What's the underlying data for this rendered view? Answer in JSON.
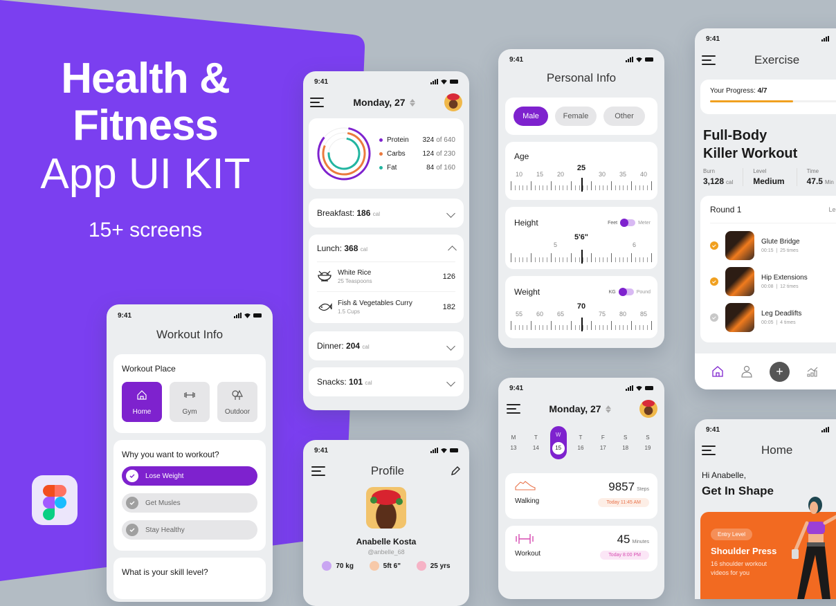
{
  "colors": {
    "accent": "#7e22ce",
    "background_purple": "#7b3ff0",
    "orange": "#f26a21",
    "progress": "#f0a020"
  },
  "hero": {
    "line1": "Health &",
    "line2": "Fitness",
    "line3": "App UI KIT",
    "subtitle": "15+ screens"
  },
  "status_time": "9:41",
  "nutrition": {
    "date": "Monday, 27",
    "macros": [
      {
        "name": "Protein",
        "value": "324",
        "of": "of 640",
        "color": "#7e22ce",
        "progress": 0.506
      },
      {
        "name": "Carbs",
        "value": "124",
        "of": "of 230",
        "color": "#ea7a3e",
        "progress": 0.539
      },
      {
        "name": "Fat",
        "value": "84",
        "of": "of 160",
        "color": "#22b5a0",
        "progress": 0.525
      }
    ],
    "meals": {
      "breakfast": {
        "label": "Breakfast:",
        "cal": "186",
        "unit": "cal"
      },
      "lunch": {
        "label": "Lunch:",
        "cal": "368",
        "unit": "cal",
        "items": [
          {
            "name": "White Rice",
            "qty": "25 Teaspoons",
            "cal": "126",
            "icon": "rice-bowl-icon"
          },
          {
            "name": "Fish & Vegetables Curry",
            "qty": "1.5 Cups",
            "cal": "182",
            "icon": "fish-icon"
          }
        ]
      },
      "dinner": {
        "label": "Dinner:",
        "cal": "204",
        "unit": "cal"
      },
      "snacks": {
        "label": "Snacks:",
        "cal": "101",
        "unit": "cal"
      }
    }
  },
  "personal_info": {
    "title": "Personal Info",
    "genders": [
      "Male",
      "Female",
      "Other"
    ],
    "selected_gender": "Male",
    "age": {
      "label": "Age",
      "value": "25",
      "ticks": [
        "10",
        "15",
        "20",
        "",
        "30",
        "35",
        "40"
      ]
    },
    "height": {
      "label": "Height",
      "value": "5'6\"",
      "unit_left": "Feet",
      "unit_right": "Meter",
      "ticks": [
        "5",
        "6"
      ]
    },
    "weight": {
      "label": "Weight",
      "value": "70",
      "unit_left": "KG",
      "unit_right": "Pound",
      "ticks": [
        "55",
        "60",
        "65",
        "",
        "75",
        "80",
        "85"
      ]
    }
  },
  "exercise": {
    "title": "Exercise",
    "progress_label": "Your Progress:",
    "progress_value": "4/7",
    "progress_fraction": 0.57,
    "workout_title_1": "Full-Body",
    "workout_title_2": "Killer Workout",
    "stats": [
      {
        "label": "Burn",
        "value": "3,128",
        "unit": "cal"
      },
      {
        "label": "Level",
        "value": "Medium",
        "unit": ""
      },
      {
        "label": "Time",
        "value": "47.5",
        "unit": "Min"
      }
    ],
    "round_label": "Round 1",
    "round_tag": "Legs & B",
    "items": [
      {
        "name": "Glute Bridge",
        "meta": "00:15  |  25 times",
        "done": true
      },
      {
        "name": "Hip Extensions",
        "meta": "00:08  |  12 times",
        "done": true
      },
      {
        "name": "Leg Deadlifts",
        "meta": "00:05  |  4 times",
        "done": false
      }
    ],
    "nav": [
      "home-icon",
      "profile-icon",
      "add-icon",
      "stats-icon"
    ]
  },
  "workout_info": {
    "title": "Workout Info",
    "place_label": "Workout Place",
    "places": [
      {
        "label": "Home",
        "selected": true
      },
      {
        "label": "Gym",
        "selected": false
      },
      {
        "label": "Outdoor",
        "selected": false
      }
    ],
    "why_label": "Why you want to workout?",
    "reasons": [
      {
        "label": "Lose Weight",
        "selected": true
      },
      {
        "label": "Get Musles",
        "selected": false
      },
      {
        "label": "Stay Healthy",
        "selected": false
      }
    ],
    "skill_label": "What is your skill level?"
  },
  "profile": {
    "title": "Profile",
    "name": "Anabelle Kosta",
    "handle": "@anbelle_68",
    "stats": [
      {
        "value": "70 kg",
        "color": "#c9a6f2"
      },
      {
        "value": "5ft 6\"",
        "color": "#f7c9a9"
      },
      {
        "value": "25 yrs",
        "color": "#f6b3c6"
      }
    ]
  },
  "activity": {
    "date": "Monday, 27",
    "days": [
      {
        "d": "M",
        "n": "13"
      },
      {
        "d": "T",
        "n": "14"
      },
      {
        "d": "W",
        "n": "15"
      },
      {
        "d": "T",
        "n": "16"
      },
      {
        "d": "F",
        "n": "17"
      },
      {
        "d": "S",
        "n": "18"
      },
      {
        "d": "S",
        "n": "19"
      }
    ],
    "selected_day": "15",
    "cards": [
      {
        "label": "Walking",
        "value": "9857",
        "unit": "Steps",
        "time": "Today 11:45 AM"
      },
      {
        "label": "Workout",
        "value": "45",
        "unit": "Minutes",
        "time": "Today 8:00 PM"
      }
    ]
  },
  "home": {
    "title": "Home",
    "greeting": "Hi Anabelle,",
    "headline": "Get In Shape",
    "promo_tag": "Entry Level",
    "promo_title": "Shoulder Press",
    "promo_desc_1": "16 shoulder workout",
    "promo_desc_2": "videos for you"
  }
}
